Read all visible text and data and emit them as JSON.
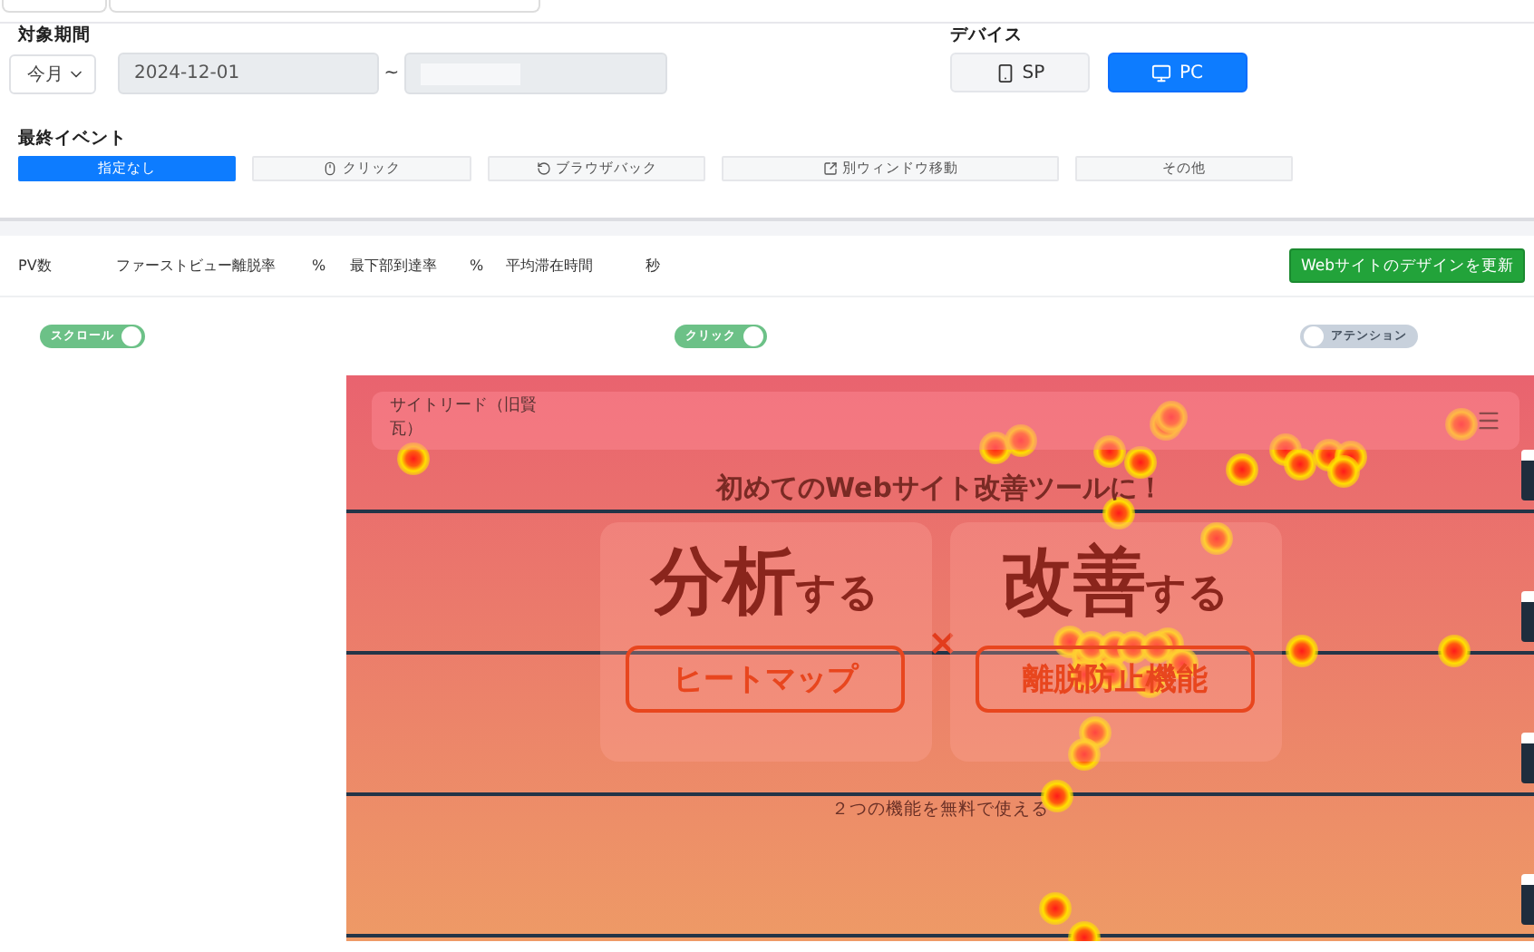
{
  "period": {
    "label": "対象期間",
    "preset": "今月",
    "start": "2024-12-01",
    "separator": "~"
  },
  "device": {
    "label": "デバイス",
    "options": [
      {
        "label": "SP",
        "kind": "phone",
        "selected": false
      },
      {
        "label": "PC",
        "kind": "desktop",
        "selected": true
      }
    ]
  },
  "last_event": {
    "label": "最終イベント",
    "options": [
      {
        "label": "指定なし",
        "kind": "none",
        "selected": true
      },
      {
        "label": "クリック",
        "kind": "click",
        "selected": false
      },
      {
        "label": "ブラウザバック",
        "kind": "back",
        "selected": false
      },
      {
        "label": "別ウィンドウ移動",
        "kind": "window",
        "selected": false
      },
      {
        "label": "その他",
        "kind": "none",
        "selected": false
      }
    ]
  },
  "stats": [
    {
      "label": "PV数"
    },
    {
      "label": "ファーストビュー離脱率",
      "unit": "%"
    },
    {
      "label": "最下部到達率",
      "unit": "%"
    },
    {
      "label": "平均滞在時間",
      "unit": "秒"
    }
  ],
  "update_button": "Webサイトのデザインを更新",
  "toggles": [
    {
      "label": "スクロール",
      "on": true
    },
    {
      "label": "クリック",
      "on": true
    },
    {
      "label": "アテンション",
      "on": false
    }
  ],
  "preview": {
    "logo_alt": "サイトリード（旧賢瓦）",
    "heading": "初めてのWebサイト改善ツールに！",
    "cards": [
      {
        "title": "分析",
        "suffix": "する",
        "button": "ヒートマップ"
      },
      {
        "title": "改善",
        "suffix": "する",
        "button": "離脱防止機能"
      }
    ],
    "joiner": "×",
    "note": "２つの機能を無料で使える"
  }
}
